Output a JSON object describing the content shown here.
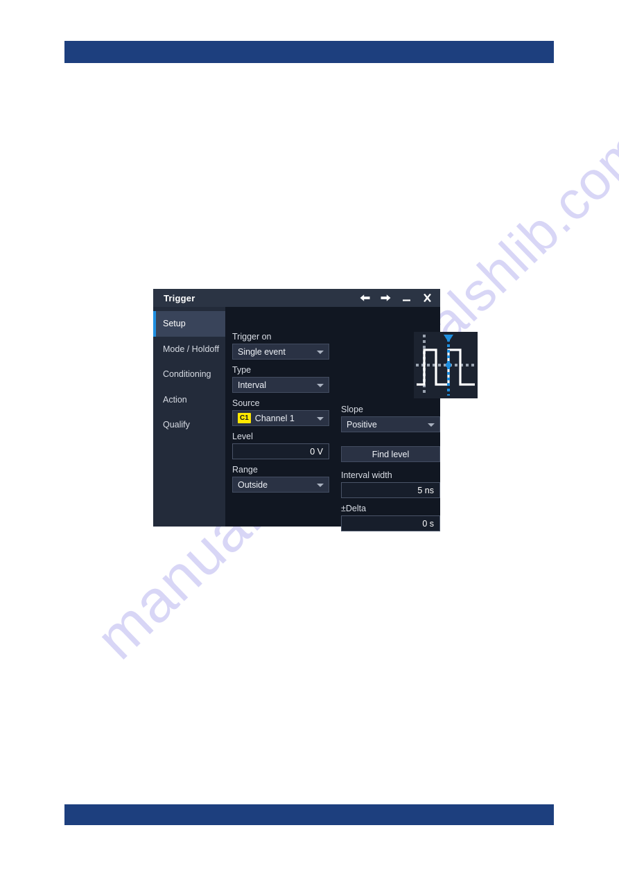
{
  "page": {
    "header_bar_color": "#1d3f7e",
    "footer_bar_color": "#1d3f7e",
    "watermark_text": "manualshlib.com"
  },
  "dialog": {
    "title": "Trigger",
    "titlebar_controls": [
      {
        "name": "back-button",
        "glyph": "arrow-left"
      },
      {
        "name": "forward-button",
        "glyph": "arrow-right"
      },
      {
        "name": "minimize-button",
        "glyph": "minimize"
      },
      {
        "name": "close-button",
        "glyph": "close"
      }
    ],
    "sidebar": {
      "items": [
        {
          "label": "Setup",
          "selected": true
        },
        {
          "label": "Mode / Holdoff",
          "selected": false
        },
        {
          "label": "Conditioning",
          "selected": false
        },
        {
          "label": "Action",
          "selected": false
        },
        {
          "label": "Qualify",
          "selected": false
        }
      ],
      "accent_color": "#1f8fe0"
    },
    "fields": {
      "trigger_on": {
        "label": "Trigger on",
        "value": "Single event",
        "control": "dropdown"
      },
      "type": {
        "label": "Type",
        "value": "Interval",
        "control": "dropdown"
      },
      "source": {
        "label": "Source",
        "badge": "C1",
        "badge_color": "#ffe800",
        "value": "Channel 1",
        "control": "dropdown"
      },
      "level": {
        "label": "Level",
        "value": "0 V",
        "control": "numeric-input"
      },
      "range": {
        "label": "Range",
        "value": "Outside",
        "control": "dropdown"
      },
      "slope": {
        "label": "Slope",
        "value": "Positive",
        "control": "dropdown"
      },
      "find_level": {
        "label": "Find level",
        "control": "button"
      },
      "interval_width": {
        "label": "Interval width",
        "value": "5 ns",
        "control": "numeric-input"
      },
      "delta": {
        "label": "±Delta",
        "value": "0 s",
        "control": "numeric-input"
      }
    },
    "preview": {
      "name": "interval-trigger-waveform-preview",
      "description": "Square wave with dashed trigger level line and dashed interval markers",
      "marker_color": "#1f8fe0",
      "waveform_color": "#ffffff"
    }
  }
}
